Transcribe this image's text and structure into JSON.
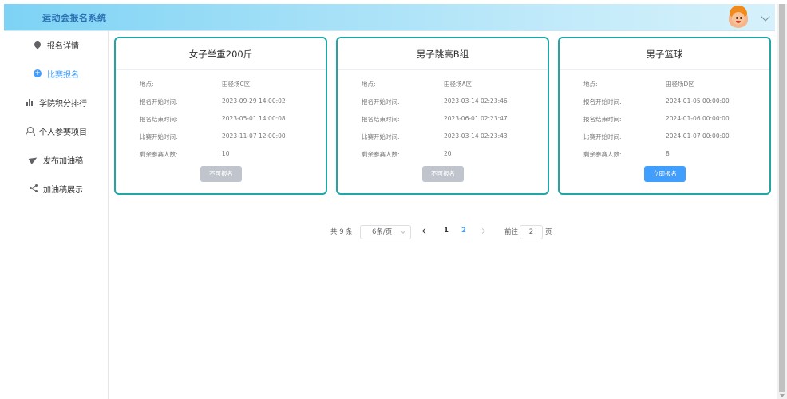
{
  "app": {
    "title": "运动会报名系统"
  },
  "sidebar": {
    "items": [
      {
        "label": "报名详情",
        "icon": "location-pin-icon",
        "active": false
      },
      {
        "label": "比赛报名",
        "icon": "plus-circle-icon",
        "active": true
      },
      {
        "label": "学院积分排行",
        "icon": "bar-chart-icon",
        "active": false
      },
      {
        "label": "个人参赛项目",
        "icon": "user-icon",
        "active": false
      },
      {
        "label": "发布加油稿",
        "icon": "send-icon",
        "active": false
      },
      {
        "label": "加油稿展示",
        "icon": "share-icon",
        "active": false
      }
    ]
  },
  "labels": {
    "location": "地点:",
    "signup_start": "报名开始时间:",
    "signup_end": "报名结束时间:",
    "match_start": "比赛开始时间:",
    "remaining": "剩余参赛人数:"
  },
  "cards": [
    {
      "title": "女子举重200斤",
      "location": "田径场C区",
      "signup_start": "2023-09-29 14:00:02",
      "signup_end": "2023-05-01 14:00:08",
      "match_start": "2023-11-07 12:00:00",
      "remaining": "10",
      "button": "不可报名",
      "button_enabled": false
    },
    {
      "title": "男子跳高B组",
      "location": "田径场A区",
      "signup_start": "2023-03-14 02:23:46",
      "signup_end": "2023-06-01 02:23:47",
      "match_start": "2023-03-14 02:23:43",
      "remaining": "20",
      "button": "不可报名",
      "button_enabled": false
    },
    {
      "title": "男子篮球",
      "location": "田径场D区",
      "signup_start": "2024-01-05 00:00:00",
      "signup_end": "2024-01-06 00:00:00",
      "match_start": "2024-01-07 00:00:00",
      "remaining": "8",
      "button": "立即报名",
      "button_enabled": true
    }
  ],
  "pagination": {
    "total": "共 9 条",
    "page_size": "6条/页",
    "pages": [
      "1",
      "2"
    ],
    "current_page": "2",
    "goto_label": "前往",
    "goto_value": "2",
    "page_suffix": "页"
  },
  "colors": {
    "accent": "#409eff",
    "card_border": "#20a6a4",
    "disabled_button": "#c0c4cc",
    "brand_text": "#2b6fb3"
  }
}
